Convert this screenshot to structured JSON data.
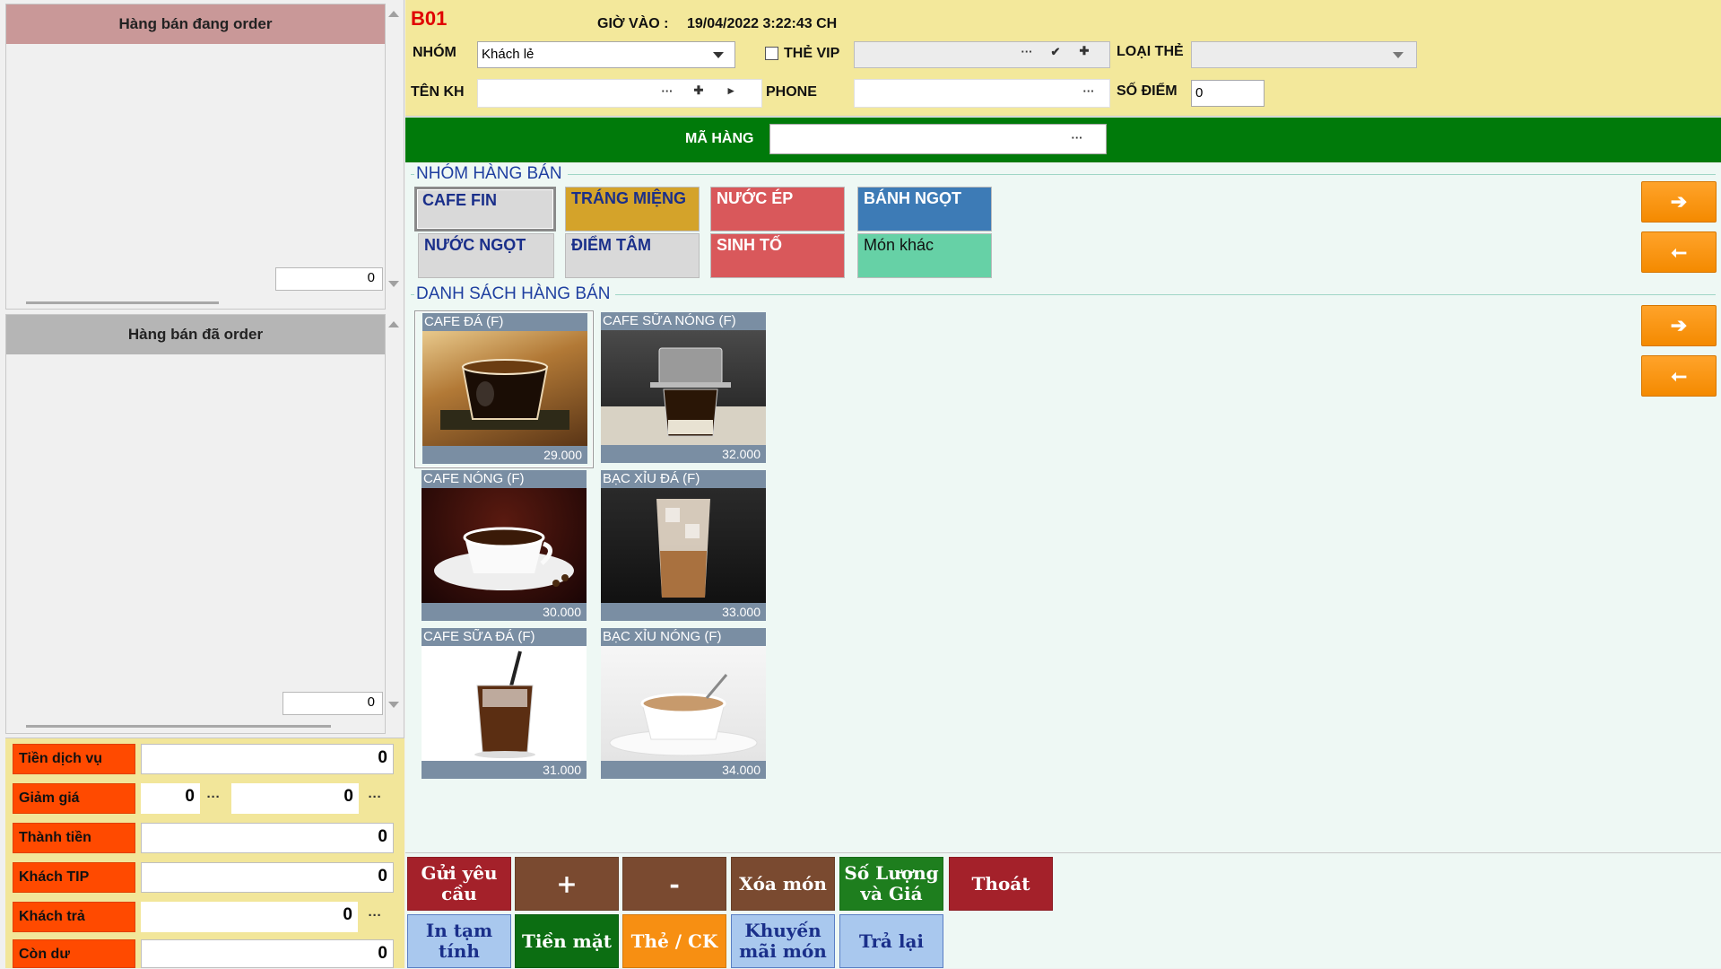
{
  "left": {
    "pending": {
      "title": "Hàng bán đang order",
      "count": "0"
    },
    "ordered": {
      "title": "Hàng bán đã order",
      "count": "0"
    },
    "summary": [
      {
        "label": "Tiền dịch vụ",
        "value": "0"
      },
      {
        "label": "Giảm giá",
        "value1": "0",
        "value2": "0"
      },
      {
        "label": "Thành tiền",
        "value": "0"
      },
      {
        "label": "Khách TIP",
        "value": "0"
      },
      {
        "label": "Khách trả",
        "value": "0"
      },
      {
        "label": "Còn dư",
        "value": "0"
      }
    ]
  },
  "header": {
    "table": "B01",
    "checkin_label": "GIỜ VÀO :",
    "checkin_value": "19/04/2022 3:22:43 CH",
    "group_label": "NHÓM",
    "group_value": "Khách lẻ",
    "vip_label": "THẺ VIP",
    "card_type_label": "LOẠI THẺ",
    "customer_label": "TÊN KH",
    "phone_label": "PHONE",
    "points_label": "SỐ ĐIỂM",
    "points_value": "0",
    "item_code_label": "MÃ HÀNG",
    "dots": "···"
  },
  "categories": {
    "title": "NHÓM HÀNG BÁN",
    "items": [
      {
        "label": "CAFE FIN",
        "color": "#d9d9d9",
        "text": "#1a2f8a"
      },
      {
        "label": "TRÁNG MIỆNG",
        "color": "#d4a32a",
        "text": "#1a2f8a"
      },
      {
        "label": "NƯỚC ÉP",
        "color": "#d9585b",
        "text": "#ffffff"
      },
      {
        "label": "BÁNH NGỌT",
        "color": "#3d7bb6",
        "text": "#ffffff"
      },
      {
        "label": "NƯỚC NGỌT",
        "color": "#d9d9d9",
        "text": "#1a2f8a"
      },
      {
        "label": "ĐIỂM TÂM",
        "color": "#d9d9d9",
        "text": "#1a2f8a"
      },
      {
        "label": "SINH TỐ",
        "color": "#d9585b",
        "text": "#ffffff"
      },
      {
        "label": "Món khác",
        "color": "#66d1a6",
        "text": "#111111"
      }
    ]
  },
  "products": {
    "title": "DANH SÁCH HÀNG BÁN",
    "items": [
      {
        "name": "CAFE ĐÁ (F)",
        "price": "29.000"
      },
      {
        "name": "CAFE SỮA NÓNG (F)",
        "price": "32.000"
      },
      {
        "name": "CAFE NÓNG (F)",
        "price": "30.000"
      },
      {
        "name": "BẠC XỈU ĐÁ (F)",
        "price": "33.000"
      },
      {
        "name": "CAFE SỮA ĐÁ (F)",
        "price": "31.000"
      },
      {
        "name": "BẠC XỈU NÓNG (F)",
        "price": "34.000"
      }
    ]
  },
  "nav": {
    "next": "➔",
    "prev": "🡐"
  },
  "buttons": {
    "row1": [
      {
        "label": "Gửi yêu cầu",
        "color": "#a4212a"
      },
      {
        "label": "+",
        "color": "#7a4a30"
      },
      {
        "label": "-",
        "color": "#7a4a30"
      },
      {
        "label": "Xóa món",
        "color": "#7a4a30"
      },
      {
        "label": "Số Lượng và Giá",
        "color": "#1e7e1e"
      },
      {
        "label": "Thoát",
        "color": "#a4212a"
      }
    ],
    "row2": [
      {
        "label": "In tạm tính",
        "color": "#a9c8ee",
        "text": "#1a2f8a"
      },
      {
        "label": "Tiền mặt",
        "color": "#0c6e12",
        "text": "#ffffff"
      },
      {
        "label": "Thẻ / CK",
        "color": "#f78f12",
        "text": "#ffffff"
      },
      {
        "label": "Khuyến mãi món",
        "color": "#a9c8ee",
        "text": "#1a2f8a"
      },
      {
        "label": "Trả lại",
        "color": "#a9c8ee",
        "text": "#1a2f8a"
      }
    ]
  }
}
